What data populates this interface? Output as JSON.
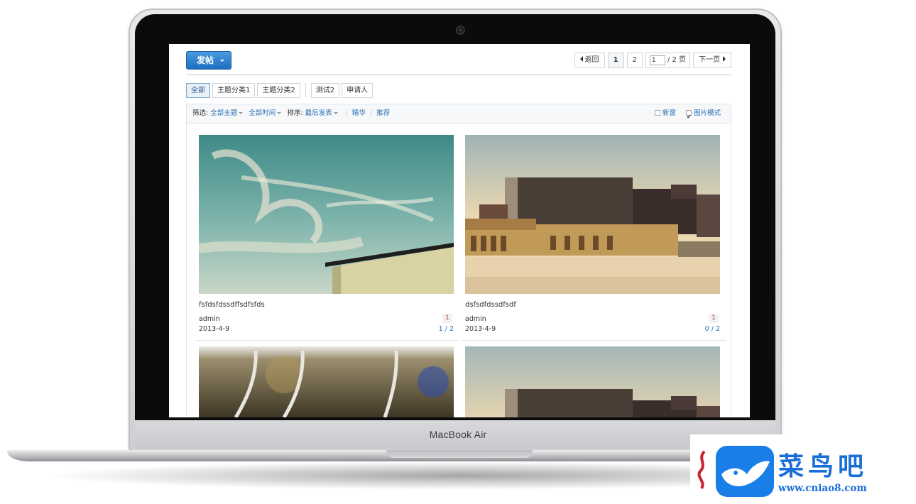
{
  "laptop": {
    "brand_label": "MacBook Air"
  },
  "toolbar": {
    "post_label": "发帖"
  },
  "pager": {
    "back_label": "返回",
    "pages": [
      "1",
      "2"
    ],
    "current_value": "1",
    "total_label": "/ 2 页",
    "next_label": "下一页"
  },
  "categories": [
    "全部",
    "主题分类1",
    "主题分类2",
    "测试2",
    "申请人"
  ],
  "filter": {
    "filter_label": "筛选:",
    "all_topics": "全部主题",
    "all_time": "全部时间",
    "sort_label": "排序:",
    "sort_value": "最后发表",
    "digest": "精华",
    "recommend": "推荐",
    "new_window": "新窗",
    "picture_mode": "图片模式"
  },
  "posts": [
    {
      "title": "fsfdsfdssdffsdfsfds",
      "author": "admin",
      "date": "2013-4-9",
      "badge": "1",
      "count": "1 / 2"
    },
    {
      "title": "dsfsdfdssdfsdf",
      "author": "admin",
      "date": "2013-4-9",
      "badge": "1",
      "count": "0 / 2"
    }
  ],
  "watermark": {
    "name": "菜鸟吧",
    "url": "www.cniao8.com"
  },
  "colors": {
    "accent": "#2a6fb4",
    "button": "#1e6ec1",
    "logo": "#1a7ee8"
  }
}
